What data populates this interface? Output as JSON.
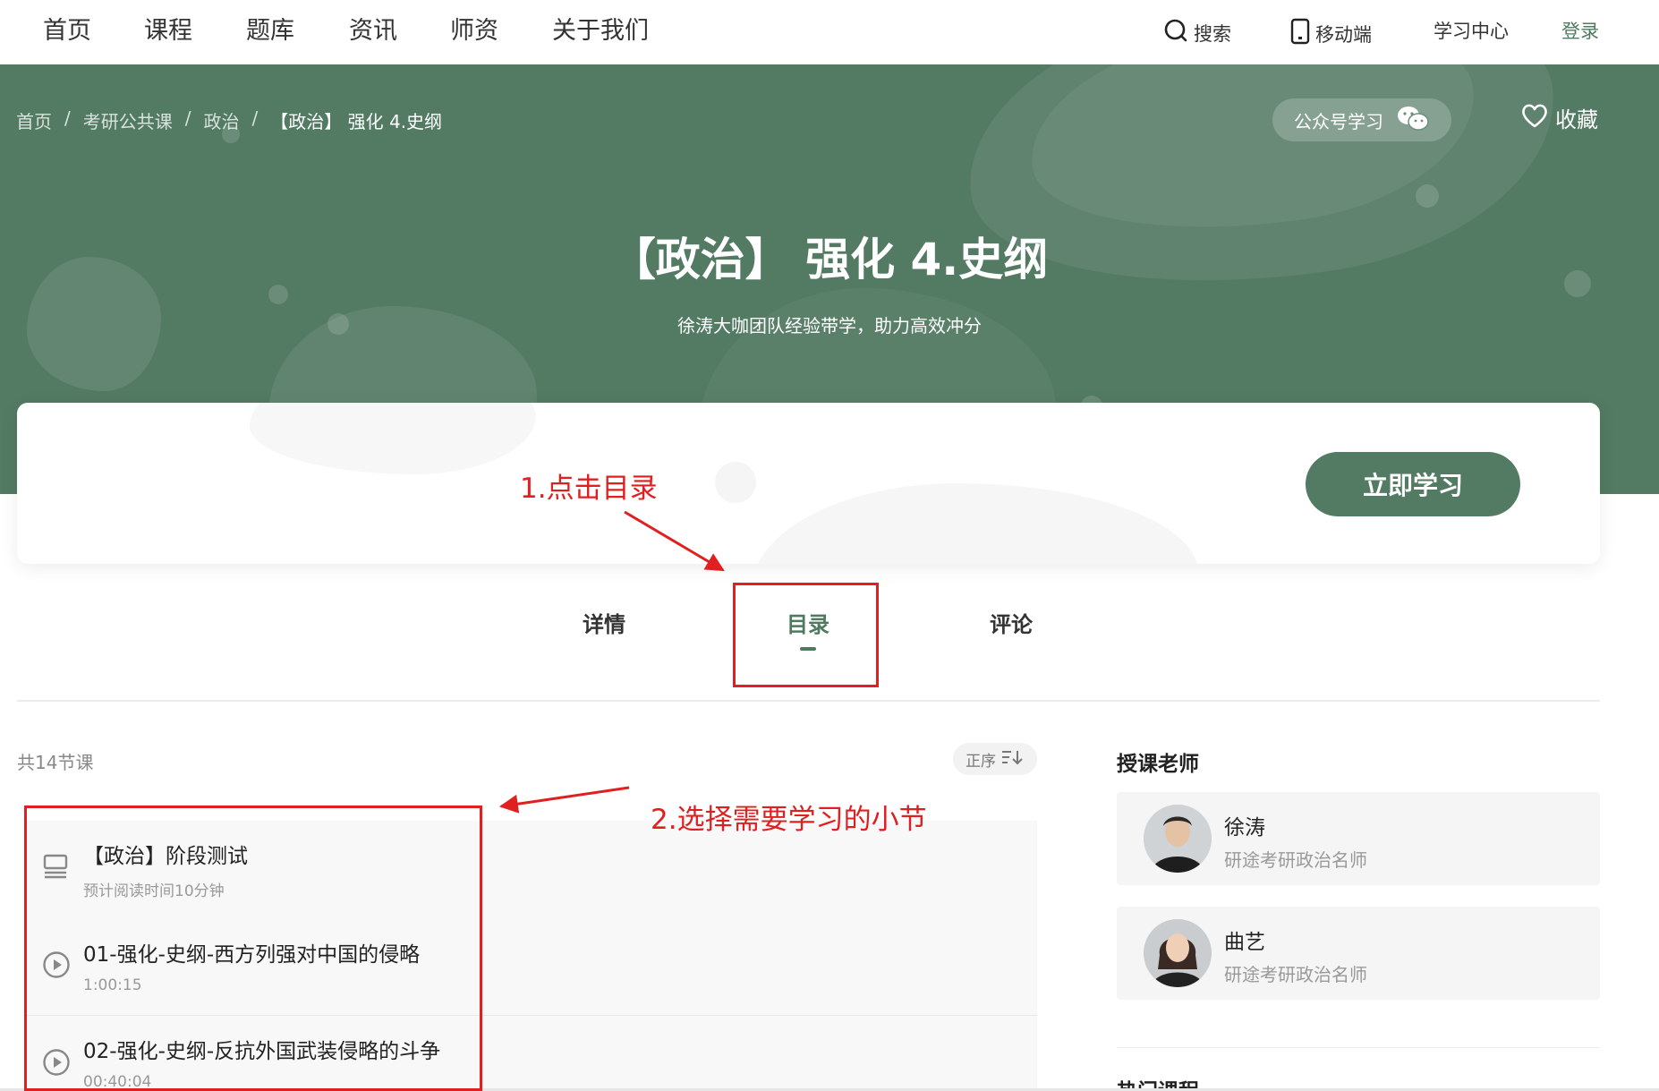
{
  "nav": {
    "items": [
      "首页",
      "课程",
      "题库",
      "资讯",
      "师资",
      "关于我们"
    ],
    "search": "搜索",
    "mobile": "移动端",
    "study_center": "学习中心",
    "login": "登录"
  },
  "breadcrumb": [
    "首页",
    "/",
    "考研公共课",
    "/",
    "政治",
    "/",
    "【政治】 强化 4.史纲"
  ],
  "hero": {
    "follow_label": "公众号学习",
    "favorite_label": "收藏",
    "title": "【政治】 强化 4.史纲",
    "subtitle": "徐涛大咖团队经验带学，助力高效冲分"
  },
  "action": {
    "study_button": "立即学习"
  },
  "tabs": {
    "details": "详情",
    "catalog": "目录",
    "comments": "评论"
  },
  "catalog": {
    "count_label": "共14节课",
    "sort_label": "正序",
    "lessons": [
      {
        "title": "【政治】阶段测试",
        "meta": "预计阅读时间10分钟",
        "icon": "document-icon"
      },
      {
        "title": "01-强化-史纲-西方列强对中国的侵略",
        "meta": "1:00:15",
        "icon": "play-circle-icon"
      },
      {
        "title": "02-强化-史纲-反抗外国武装侵略的斗争",
        "meta": "00:40:04",
        "icon": "play-circle-icon"
      }
    ]
  },
  "teachers": {
    "heading": "授课老师",
    "list": [
      {
        "name": "徐涛",
        "title": "研途考研政治名师"
      },
      {
        "name": "曲艺",
        "title": "研途考研政治名师"
      }
    ],
    "hot_heading": "热门课程"
  },
  "annotations": {
    "step1": "1.点击目录",
    "step2": "2.选择需要学习的小节"
  },
  "colors": {
    "brand_green": "#537a63",
    "annotation_red": "#e02020"
  }
}
